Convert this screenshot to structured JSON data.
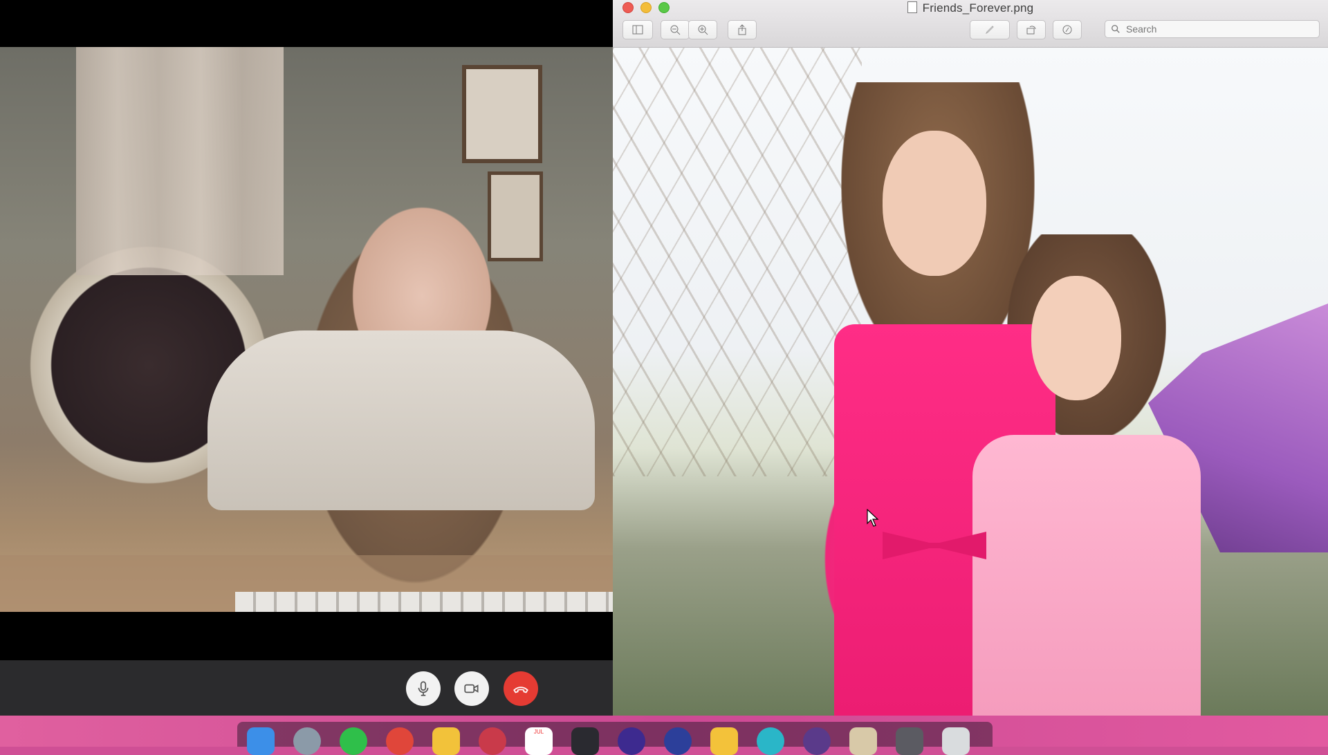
{
  "call": {
    "controls": {
      "mute": {
        "icon": "microphone-icon"
      },
      "camera": {
        "icon": "video-camera-icon"
      },
      "end": {
        "icon": "hang-up-icon",
        "color": "#e53b33"
      }
    }
  },
  "preview": {
    "title": "Friends_Forever.png",
    "toolbar": {
      "sidebar": {
        "icon": "sidebar-icon"
      },
      "zoom_out": {
        "icon": "zoom-out-icon"
      },
      "zoom_in": {
        "icon": "zoom-in-icon"
      },
      "share": {
        "icon": "share-icon"
      },
      "markup": {
        "icon": "pen-icon"
      },
      "rotate": {
        "icon": "rotate-icon"
      },
      "annotate": {
        "icon": "markup-circle-icon"
      }
    },
    "search": {
      "placeholder": "Search"
    }
  },
  "dock": {
    "apps": [
      {
        "name": "finder",
        "color": "#3c8fe8"
      },
      {
        "name": "launchpad",
        "color": "#8b9aa8"
      },
      {
        "name": "whatsapp",
        "color": "#2fbf4a"
      },
      {
        "name": "chrome",
        "color": "#e0463a"
      },
      {
        "name": "notes",
        "color": "#f2c23a"
      },
      {
        "name": "photo-booth",
        "color": "#c93a4a"
      },
      {
        "name": "calendar",
        "color": "#ffffff",
        "label": "JUL"
      },
      {
        "name": "games",
        "color": "#2a2a30"
      },
      {
        "name": "app-purple",
        "color": "#3d2a8f"
      },
      {
        "name": "app-blue-dark",
        "color": "#2c3f9a"
      },
      {
        "name": "starred",
        "color": "#f3c23a"
      },
      {
        "name": "app-teal",
        "color": "#2ab6c8"
      },
      {
        "name": "app-violet",
        "color": "#5a3a8a"
      },
      {
        "name": "preview",
        "color": "#d8c9a8"
      },
      {
        "name": "system-preferences",
        "color": "#5b5b62"
      },
      {
        "name": "trash",
        "color": "#d9dcde"
      }
    ]
  }
}
